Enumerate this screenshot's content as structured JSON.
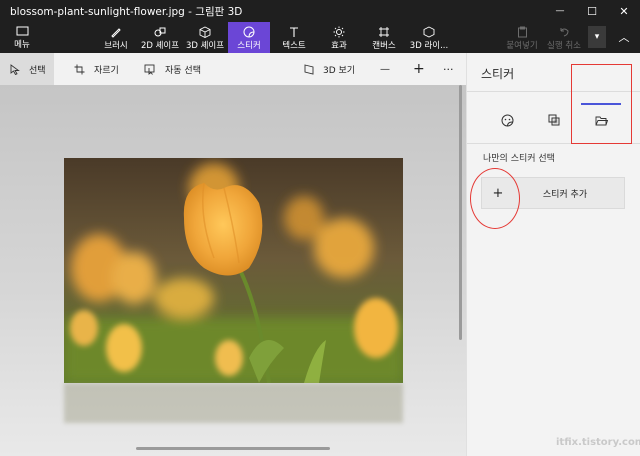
{
  "titlebar": {
    "title": "blossom-plant-sunlight-flower.jpg - 그림판 3D",
    "minimize": "—",
    "maximize": "☐",
    "close": "✕"
  },
  "commandbar": {
    "menu_label": "메뉴",
    "brushes": "브러시",
    "shapes_2d": "2D 셰이프",
    "shapes_3d": "3D 셰이프",
    "stickers": "스티커",
    "text": "텍스트",
    "effects": "효과",
    "canvas": "캔버스",
    "library_3d": "3D 라이...",
    "paste": "붙여넣기",
    "undo": "실행 취소",
    "more": "▾",
    "collapse": "︿"
  },
  "toolbar2": {
    "select": "선택",
    "crop": "자르기",
    "magic_select": "자동 선택",
    "view_3d": "3D 보기",
    "zoom_out": "—",
    "zoom_in": "+",
    "more": "···"
  },
  "panel": {
    "title": "스티커",
    "section_label": "나만의 스티커 선택",
    "add_plus": "+",
    "add_label": "스티커 추가",
    "active_tab": "custom-stickers"
  },
  "watermark": "itfix.tistory.com",
  "colors": {
    "accent": "#6b46d6",
    "tab_underline": "#4a55d9",
    "annotation": "#e53935"
  }
}
